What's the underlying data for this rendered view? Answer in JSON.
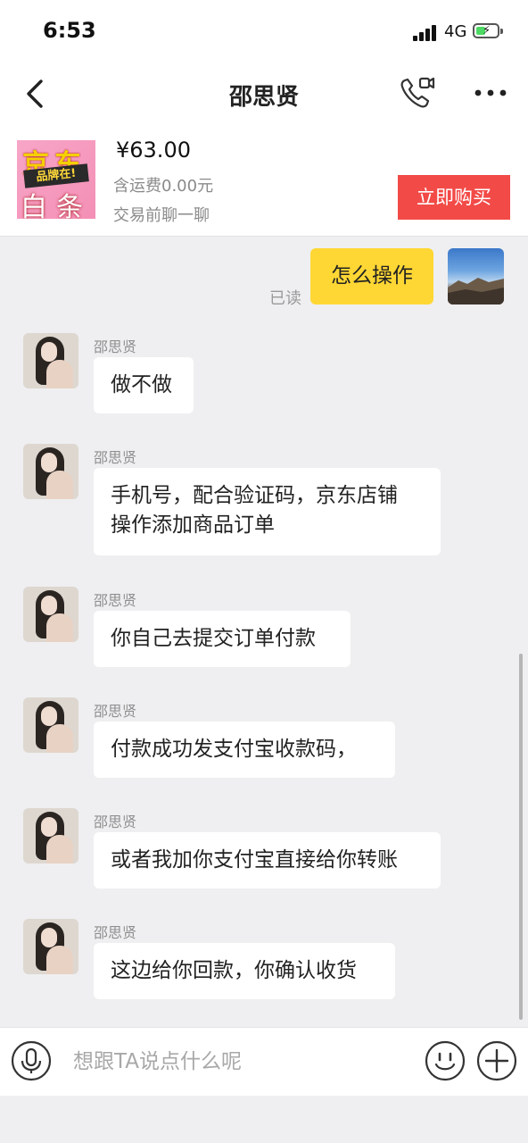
{
  "status": {
    "time": "6:53",
    "network": "4G",
    "battery_charging": true
  },
  "nav": {
    "title": "邵思贤",
    "back_icon": "chevron-left-icon",
    "call_icon": "phone-video-icon",
    "more_icon": "more-dots-icon"
  },
  "product": {
    "thumb_text_top": "京东",
    "thumb_text_badge": "品牌在!",
    "thumb_text_bottom": "白条",
    "price": "¥63.00",
    "shipping": "含运费0.00元",
    "note": "交易前聊一聊",
    "buy_label": "立即购买",
    "buy_color": "#f24a47"
  },
  "chat": {
    "outgoing": {
      "text": "怎么操作",
      "read_status": "已读",
      "bubble_color": "#ffd734"
    },
    "messages": [
      {
        "sender": "邵思贤",
        "lines": [
          "做不做"
        ]
      },
      {
        "sender": "邵思贤",
        "lines": [
          "手机号，配合验证码，京东店铺",
          "操作添加商品订单"
        ]
      },
      {
        "sender": "邵思贤",
        "lines": [
          "你自己去提交订单付款"
        ]
      },
      {
        "sender": "邵思贤",
        "lines": [
          "付款成功发支付宝收款码，"
        ]
      },
      {
        "sender": "邵思贤",
        "lines": [
          "或者我加你支付宝直接给你转账"
        ]
      },
      {
        "sender": "邵思贤",
        "lines": [
          "这边给你回款，你确认收货"
        ]
      }
    ]
  },
  "input": {
    "placeholder": "想跟TA说点什么呢",
    "mic_icon": "microphone-icon",
    "emoji_icon": "smiley-icon",
    "plus_icon": "plus-circle-icon"
  }
}
